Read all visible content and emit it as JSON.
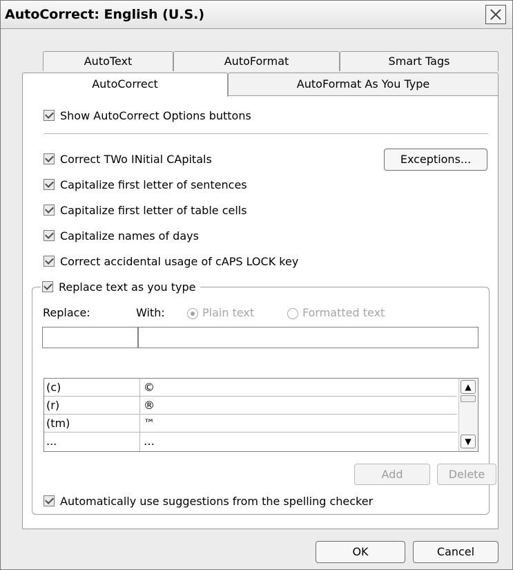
{
  "window": {
    "title": "AutoCorrect: English (U.S.)"
  },
  "tabs": {
    "row1": [
      "AutoText",
      "AutoFormat",
      "Smart Tags"
    ],
    "row2": [
      "AutoCorrect",
      "AutoFormat As You Type"
    ],
    "active": "AutoCorrect"
  },
  "options": {
    "show_buttons": "Show AutoCorrect Options buttons",
    "correct_two_initial": "Correct TWo INitial CApitals",
    "cap_sentences": "Capitalize first letter of sentences",
    "cap_table_cells": "Capitalize first letter of table cells",
    "cap_days": "Capitalize names of days",
    "caps_lock": "Correct accidental usage of cAPS LOCK key",
    "replace_as_type": "Replace text as you type",
    "use_suggestions": "Automatically use suggestions from the spelling checker"
  },
  "buttons": {
    "exceptions": "Exceptions...",
    "add": "Add",
    "delete": "Delete",
    "ok": "OK",
    "cancel": "Cancel"
  },
  "replace_section": {
    "replace_label": "Replace:",
    "with_label": "With:",
    "plain_text": "Plain text",
    "formatted_text": "Formatted text",
    "replace_value": "",
    "with_value": ""
  },
  "entries": [
    {
      "replace": "(c)",
      "with": "©"
    },
    {
      "replace": "(r)",
      "with": "®"
    },
    {
      "replace": "(tm)",
      "with": "™"
    },
    {
      "replace": "...",
      "with": "…"
    }
  ]
}
